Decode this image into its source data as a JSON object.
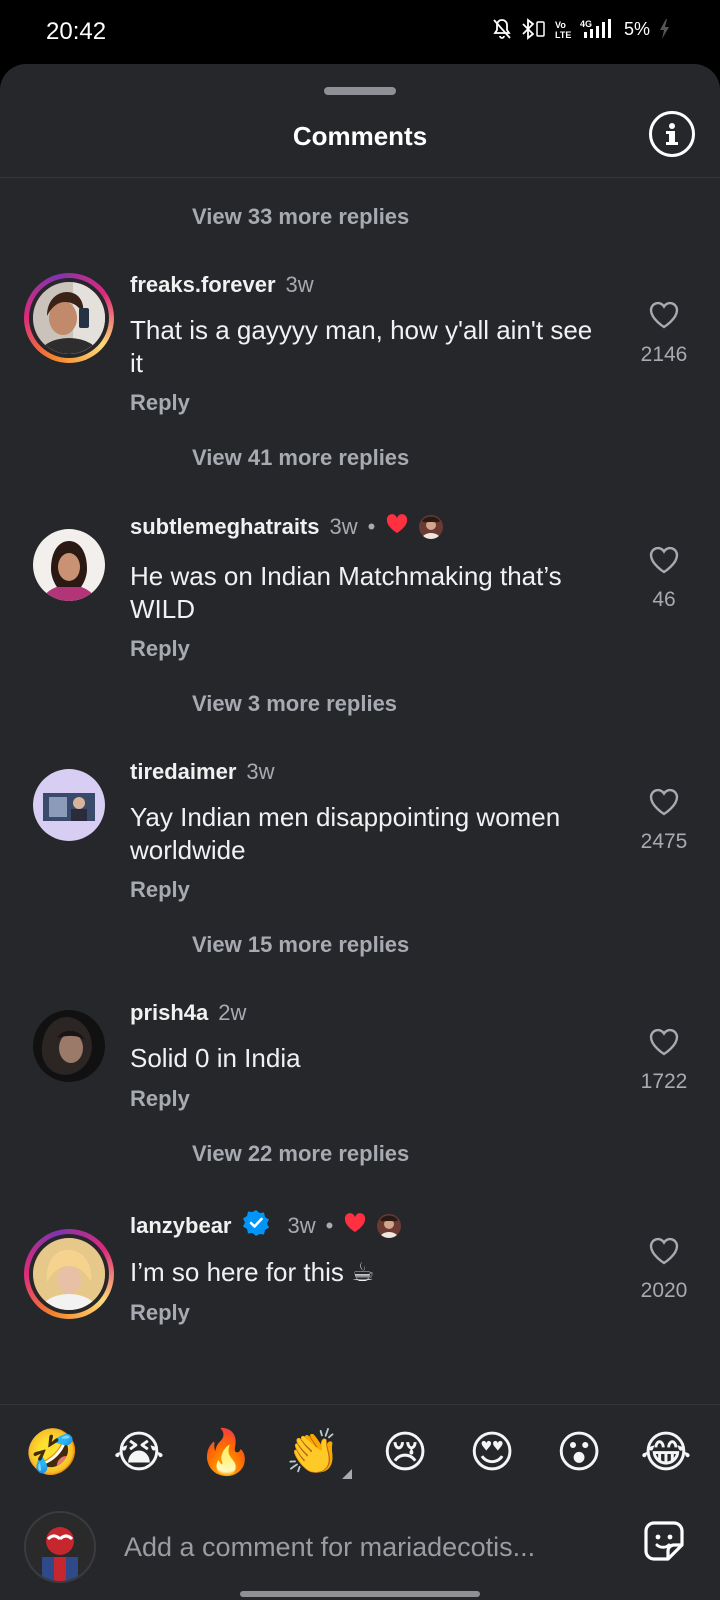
{
  "status_bar": {
    "time": "20:42",
    "battery": "5%",
    "icons": [
      "mute-icon",
      "bluetooth-icon",
      "volte-icon",
      "4g-signal-icon",
      "battery-charging-icon"
    ]
  },
  "sheet": {
    "title": "Comments",
    "info_icon": "info-icon"
  },
  "threads": [
    {
      "view_replies": "View 33 more replies"
    },
    {
      "username": "freaks.forever",
      "time": "3w",
      "text": "That is a gayyyy man, how y'all ain't see it",
      "reply_label": "Reply",
      "likes": "2146",
      "view_replies": "View 41 more replies"
    },
    {
      "username": "subtlemeghatraits",
      "time": "3w",
      "creator_liked": true,
      "text": "He was on Indian Matchmaking that’s WILD",
      "reply_label": "Reply",
      "likes": "46",
      "view_replies": "View 3 more replies"
    },
    {
      "username": "tiredaimer",
      "time": "3w",
      "text": "Yay Indian men disappointing women worldwide",
      "reply_label": "Reply",
      "likes": "2475",
      "view_replies": "View 15 more replies"
    },
    {
      "username": "prish4a",
      "time": "2w",
      "text": "Solid 0 in India",
      "reply_label": "Reply",
      "likes": "1722",
      "view_replies": "View 22 more replies"
    },
    {
      "username": "lanzybear",
      "verified": true,
      "time": "3w",
      "creator_liked": true,
      "text": "I’m so here for this ☕",
      "reply_label": "Reply",
      "likes": "2020"
    }
  ],
  "emoji_bar": [
    "🤣",
    "😭",
    "🔥",
    "👏",
    "😢",
    "😍",
    "😮",
    "😂"
  ],
  "composer": {
    "placeholder": "Add a comment for mariadecotis...",
    "sticker_icon": "sticker-icon"
  },
  "colors": {
    "sheet_bg": "#25272b",
    "secondary_text": "#a7aab0",
    "like_red": "#ff3040",
    "verified_blue": "#0095f6"
  }
}
